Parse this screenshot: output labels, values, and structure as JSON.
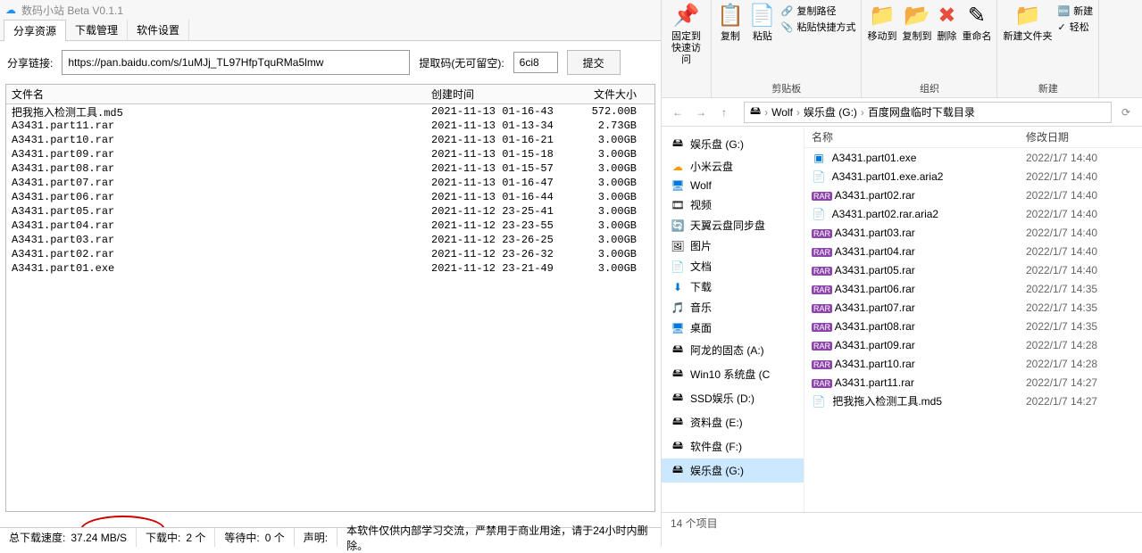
{
  "app": {
    "title": "数码小站 Beta V0.1.1",
    "tabs": [
      "分享资源",
      "下载管理",
      "软件设置"
    ],
    "shareLabel": "分享链接:",
    "shareUrl": "https://pan.baidu.com/s/1uMJj_TL97HfpTquRMa5lmw",
    "codeLabel": "提取码(无可留空):",
    "codeValue": "6ci8",
    "submit": "提交",
    "cols": {
      "name": "文件名",
      "date": "创建时间",
      "size": "文件大小"
    },
    "files": [
      {
        "name": "把我拖入检测工具.md5",
        "date": "2021-11-13 01-16-43",
        "size": "572.00B"
      },
      {
        "name": "A3431.part11.rar",
        "date": "2021-11-13 01-13-34",
        "size": "2.73GB"
      },
      {
        "name": "A3431.part10.rar",
        "date": "2021-11-13 01-16-21",
        "size": "3.00GB"
      },
      {
        "name": "A3431.part09.rar",
        "date": "2021-11-13 01-15-18",
        "size": "3.00GB"
      },
      {
        "name": "A3431.part08.rar",
        "date": "2021-11-13 01-15-57",
        "size": "3.00GB"
      },
      {
        "name": "A3431.part07.rar",
        "date": "2021-11-13 01-16-47",
        "size": "3.00GB"
      },
      {
        "name": "A3431.part06.rar",
        "date": "2021-11-13 01-16-44",
        "size": "3.00GB"
      },
      {
        "name": "A3431.part05.rar",
        "date": "2021-11-12 23-25-41",
        "size": "3.00GB"
      },
      {
        "name": "A3431.part04.rar",
        "date": "2021-11-12 23-23-55",
        "size": "3.00GB"
      },
      {
        "name": "A3431.part03.rar",
        "date": "2021-11-12 23-26-25",
        "size": "3.00GB"
      },
      {
        "name": "A3431.part02.rar",
        "date": "2021-11-12 23-26-32",
        "size": "3.00GB"
      },
      {
        "name": "A3431.part01.exe",
        "date": "2021-11-12 23-21-49",
        "size": "3.00GB"
      }
    ],
    "status": {
      "speedLabel": "总下载速度:",
      "speed": "37.24 MB/S",
      "dlLabel": "下载中:",
      "dlCount": "2 个",
      "waitLabel": "等待中:",
      "waitCount": "0 个",
      "noticeLabel": "声明:",
      "notice": "本软件仅供内部学习交流，严禁用于商业用途，请于24小时内删除。"
    }
  },
  "explorer": {
    "ribbon": {
      "pin": "固定到快速访问",
      "copy": "复制",
      "paste": "粘贴",
      "copyPath": "复制路径",
      "pasteShortcut": "粘贴快捷方式",
      "clipboard": "剪贴板",
      "moveTo": "移动到",
      "copyTo": "复制到",
      "delete": "删除",
      "rename": "重命名",
      "organize": "组织",
      "newFolder": "新建文件夹",
      "newMenu": "新建",
      "easy": "轻松",
      "new": "新建"
    },
    "breadcrumb": {
      "segs": [
        "Wolf",
        "娱乐盘 (G:)",
        "百度网盘临时下载目录"
      ]
    },
    "nav": [
      {
        "icon": "🖴",
        "label": "娱乐盘 (G:)"
      },
      {
        "icon": "☁",
        "label": "小米云盘",
        "color": "#f90"
      },
      {
        "icon": "🖥",
        "label": "Wolf",
        "color": "#0078d7"
      },
      {
        "icon": "🎞",
        "label": "视频"
      },
      {
        "icon": "🔄",
        "label": "天翼云盘同步盘",
        "color": "#00b0f0"
      },
      {
        "icon": "🖼",
        "label": "图片"
      },
      {
        "icon": "📄",
        "label": "文档"
      },
      {
        "icon": "⬇",
        "label": "下载",
        "color": "#0078d7"
      },
      {
        "icon": "🎵",
        "label": "音乐",
        "color": "#0078d7"
      },
      {
        "icon": "🖥",
        "label": "桌面",
        "color": "#0078d7"
      },
      {
        "icon": "🖴",
        "label": "阿龙的固态 (A:)"
      },
      {
        "icon": "🖴",
        "label": "Win10 系统盘 (C"
      },
      {
        "icon": "🖴",
        "label": "SSD娱乐 (D:)"
      },
      {
        "icon": "🖴",
        "label": "资料盘 (E:)"
      },
      {
        "icon": "🖴",
        "label": "软件盘 (F:)"
      },
      {
        "icon": "🖴",
        "label": "娱乐盘 (G:)",
        "selected": true
      }
    ],
    "cols": {
      "name": "名称",
      "date": "修改日期"
    },
    "files": [
      {
        "icon": "exe",
        "name": "A3431.part01.exe",
        "date": "2022/1/7 14:40"
      },
      {
        "icon": "file",
        "name": "A3431.part01.exe.aria2",
        "date": "2022/1/7 14:40"
      },
      {
        "icon": "rar",
        "name": "A3431.part02.rar",
        "date": "2022/1/7 14:40"
      },
      {
        "icon": "file",
        "name": "A3431.part02.rar.aria2",
        "date": "2022/1/7 14:40"
      },
      {
        "icon": "rar",
        "name": "A3431.part03.rar",
        "date": "2022/1/7 14:40"
      },
      {
        "icon": "rar",
        "name": "A3431.part04.rar",
        "date": "2022/1/7 14:40"
      },
      {
        "icon": "rar",
        "name": "A3431.part05.rar",
        "date": "2022/1/7 14:40"
      },
      {
        "icon": "rar",
        "name": "A3431.part06.rar",
        "date": "2022/1/7 14:35"
      },
      {
        "icon": "rar",
        "name": "A3431.part07.rar",
        "date": "2022/1/7 14:35"
      },
      {
        "icon": "rar",
        "name": "A3431.part08.rar",
        "date": "2022/1/7 14:35"
      },
      {
        "icon": "rar",
        "name": "A3431.part09.rar",
        "date": "2022/1/7 14:28"
      },
      {
        "icon": "rar",
        "name": "A3431.part10.rar",
        "date": "2022/1/7 14:28"
      },
      {
        "icon": "rar",
        "name": "A3431.part11.rar",
        "date": "2022/1/7 14:27"
      },
      {
        "icon": "file",
        "name": "把我拖入检测工具.md5",
        "date": "2022/1/7 14:27"
      }
    ],
    "status": "14 个项目"
  }
}
